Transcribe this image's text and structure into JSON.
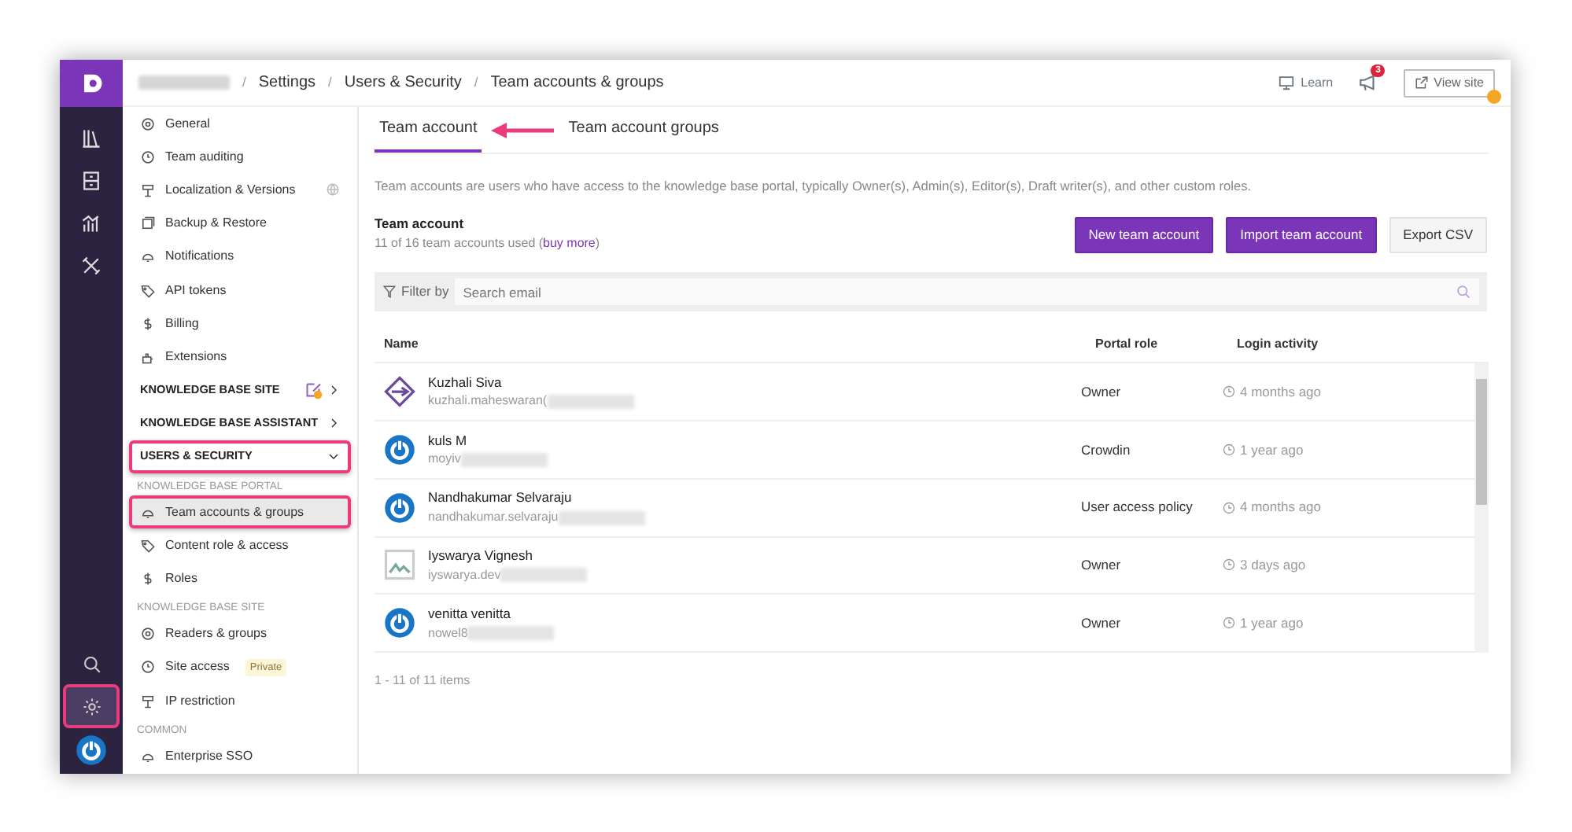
{
  "rail": {
    "items": [
      {
        "selected": false
      },
      {
        "selected": false
      },
      {
        "selected": false
      },
      {
        "selected": false
      }
    ],
    "bottom_items": [
      {
        "selected": false,
        "highlighted": false
      },
      {
        "selected": true,
        "highlighted": true
      }
    ]
  },
  "breadcrumb": [
    {
      "separator": "/",
      "label": "Settings"
    },
    {
      "separator": "/",
      "label": "Users & Security"
    },
    {
      "separator": "/",
      "label": "Team accounts & groups"
    }
  ],
  "topbar": {
    "learn": "Learn",
    "notifications": "3",
    "view_site": "View site"
  },
  "sidebar": {
    "entries": [
      {
        "kind": "item",
        "label": "General",
        "selected": false,
        "highlighted": false
      },
      {
        "kind": "item",
        "label": "Team auditing",
        "selected": false,
        "highlighted": false
      },
      {
        "kind": "item",
        "label": "Localization & Versions",
        "selected": false,
        "highlighted": false
      },
      {
        "kind": "item",
        "label": "Backup & Restore",
        "selected": false,
        "highlighted": false
      },
      {
        "kind": "item",
        "label": "Notifications",
        "selected": false,
        "highlighted": false
      },
      {
        "kind": "item",
        "label": "API tokens",
        "selected": false,
        "highlighted": false
      },
      {
        "kind": "item",
        "label": "Billing",
        "selected": false,
        "highlighted": false
      },
      {
        "kind": "item",
        "label": "Extensions",
        "selected": false,
        "highlighted": false
      },
      {
        "kind": "section",
        "label": "KNOWLEDGE BASE SITE",
        "expanded": false,
        "highlighted": false
      },
      {
        "kind": "section",
        "label": "KNOWLEDGE BASE ASSISTANT",
        "expanded": false,
        "highlighted": false
      },
      {
        "kind": "section",
        "label": "USERS & SECURITY",
        "expanded": true,
        "highlighted": true
      },
      {
        "kind": "group",
        "label": "KNOWLEDGE BASE PORTAL"
      },
      {
        "kind": "item",
        "label": "Team accounts & groups",
        "selected": true,
        "highlighted": true
      },
      {
        "kind": "item",
        "label": "Content role & access",
        "selected": false,
        "highlighted": false
      },
      {
        "kind": "item",
        "label": "Roles",
        "selected": false,
        "highlighted": false
      },
      {
        "kind": "group",
        "label": "KNOWLEDGE BASE SITE"
      },
      {
        "kind": "item",
        "label": "Readers & groups",
        "selected": false,
        "highlighted": false
      },
      {
        "kind": "item",
        "label": "Site access",
        "selected": false,
        "highlighted": false,
        "badge": "Private"
      },
      {
        "kind": "item",
        "label": "IP restriction",
        "selected": false,
        "highlighted": false
      },
      {
        "kind": "group",
        "label": "COMMON"
      },
      {
        "kind": "item",
        "label": "Enterprise SSO",
        "selected": false,
        "highlighted": false
      }
    ]
  },
  "tabs": [
    {
      "label": "Team account",
      "selected": true
    },
    {
      "label": "Team account groups",
      "selected": false
    }
  ],
  "description": "Team accounts are users who have access to the knowledge base portal, typically Owner(s), Admin(s), Editor(s), Draft writer(s), and other custom roles.",
  "team": {
    "title": "Team account",
    "usage": {
      "prefix": "11 of 16 team accounts used (",
      "link": "buy more",
      "suffix": ")"
    }
  },
  "buttons": [
    {
      "label": "New team account",
      "kind": "primary"
    },
    {
      "label": "Import team account",
      "kind": "primary"
    },
    {
      "label": "Export CSV",
      "kind": "light"
    }
  ],
  "filter": {
    "label": "Filter by",
    "placeholder": "Search email"
  },
  "table": {
    "columns": [
      "Name",
      "Portal role",
      "Login activity"
    ],
    "rows": [
      {
        "kind": "logo",
        "name": "Kuzhali Siva",
        "email": "kuzhali.maheswaran(",
        "role": "Owner",
        "login": "4 months ago"
      },
      {
        "kind": "power",
        "name": "kuls M",
        "email": "moyiv",
        "role": "Crowdin",
        "login": "1 year ago"
      },
      {
        "kind": "power",
        "name": "Nandhakumar Selvaraju",
        "email": "nandhakumar.selvaraju",
        "role": "User access policy",
        "login": "4 months ago"
      },
      {
        "kind": "broken",
        "name": "Iyswarya Vignesh",
        "email": "iyswarya.dev",
        "role": "Owner",
        "login": "3 days ago"
      },
      {
        "kind": "power",
        "name": "venitta venitta",
        "email": "nowel8",
        "role": "Owner",
        "login": "1 year ago"
      }
    ]
  },
  "pager": "1 - 11 of 11 items"
}
